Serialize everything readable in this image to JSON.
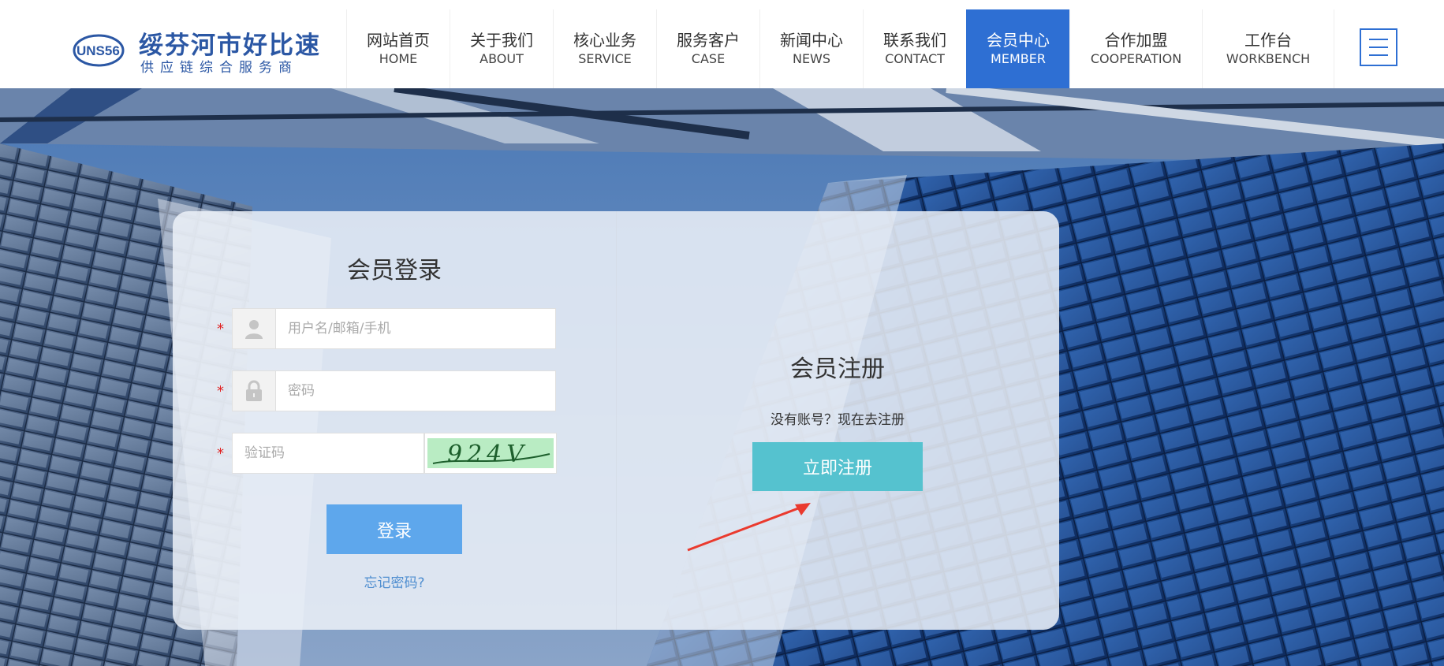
{
  "logo": {
    "mark_text": "UNS56",
    "title": "绥芬河市好比速",
    "subtitle": "供应链综合服务商"
  },
  "nav": {
    "items": [
      {
        "zh": "网站首页",
        "en": "HOME"
      },
      {
        "zh": "关于我们",
        "en": "ABOUT"
      },
      {
        "zh": "核心业务",
        "en": "SERVICE"
      },
      {
        "zh": "服务客户",
        "en": "CASE"
      },
      {
        "zh": "新闻中心",
        "en": "NEWS"
      },
      {
        "zh": "联系我们",
        "en": "CONTACT"
      },
      {
        "zh": "会员中心",
        "en": "MEMBER"
      },
      {
        "zh": "合作加盟",
        "en": "COOPERATION"
      },
      {
        "zh": "工作台",
        "en": "WORKBENCH"
      }
    ],
    "active": "MEMBER",
    "active_color": "#2e6fd3",
    "menu_icon": "hamburger-menu-icon"
  },
  "login": {
    "title": "会员登录",
    "username_placeholder": "用户名/邮箱/手机",
    "password_placeholder": "密码",
    "captcha_placeholder": "验证码",
    "captcha_text": "924V",
    "required_mark": "*",
    "submit_label": "登录",
    "forgot_label": "忘记密码?",
    "user_icon": "user-icon",
    "lock_icon": "lock-icon",
    "button_color": "#5ea7ec"
  },
  "register": {
    "title": "会员注册",
    "description": "没有账号？现在去注册",
    "button_label": "立即注册",
    "button_color": "#55c2cf"
  }
}
